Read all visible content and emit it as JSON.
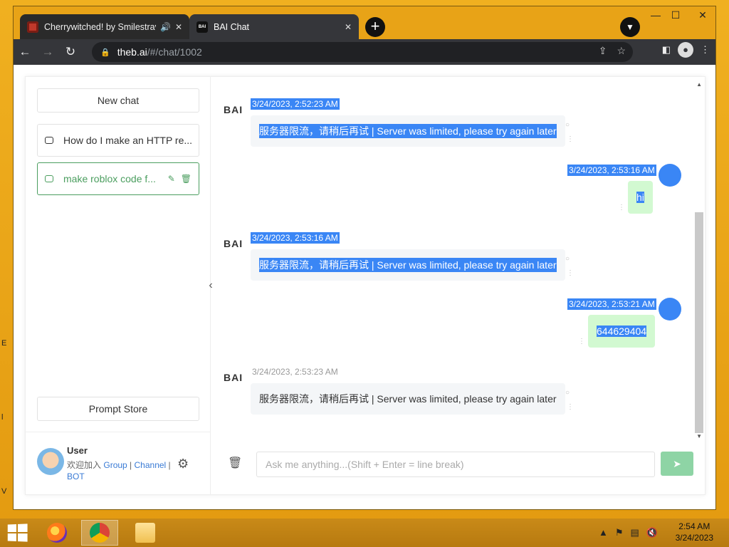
{
  "browser": {
    "tabs": [
      {
        "title": "Cherrywitched! by Smilestrav",
        "state": "inactive"
      },
      {
        "title": "BAI Chat",
        "state": "active"
      }
    ],
    "url_host": "theb.ai",
    "url_path": "/#/chat/1002"
  },
  "sidebar": {
    "new_chat_label": "New chat",
    "conversations": [
      {
        "title": "How do I make an HTTP re..."
      },
      {
        "title": "make roblox code f..."
      }
    ],
    "prompt_store_label": "Prompt Store",
    "user": {
      "name": "User",
      "desc_prefix": "欢迎加入",
      "links": [
        "Group",
        "Channel",
        "BOT"
      ]
    }
  },
  "bot_name": "BAI",
  "messages": [
    {
      "role": "bot",
      "time": "3/24/2023, 2:52:23 AM",
      "text": "服务器限流，请稍后再试 | Server was limited, please try again later",
      "selected": true
    },
    {
      "role": "user",
      "time": "3/24/2023, 2:53:16 AM",
      "text": "hi",
      "selected": true
    },
    {
      "role": "bot",
      "time": "3/24/2023, 2:53:16 AM",
      "text": "服务器限流，请稍后再试 | Server was limited, please try again later",
      "selected": true
    },
    {
      "role": "user",
      "time": "3/24/2023, 2:53:21 AM",
      "text": "644629404",
      "selected": true
    },
    {
      "role": "bot",
      "time": "3/24/2023, 2:53:23 AM",
      "text": "服务器限流，请稍后再试 | Server was limited, please try again later",
      "selected": false
    }
  ],
  "composer": {
    "placeholder": "Ask me anything...(Shift + Enter = line break)"
  },
  "taskbar": {
    "time": "2:54 AM",
    "date": "3/24/2023"
  },
  "colors": {
    "accent": "#4b9e5f",
    "selection": "#3a86f5",
    "user_bubble": "#d2f9d1"
  }
}
